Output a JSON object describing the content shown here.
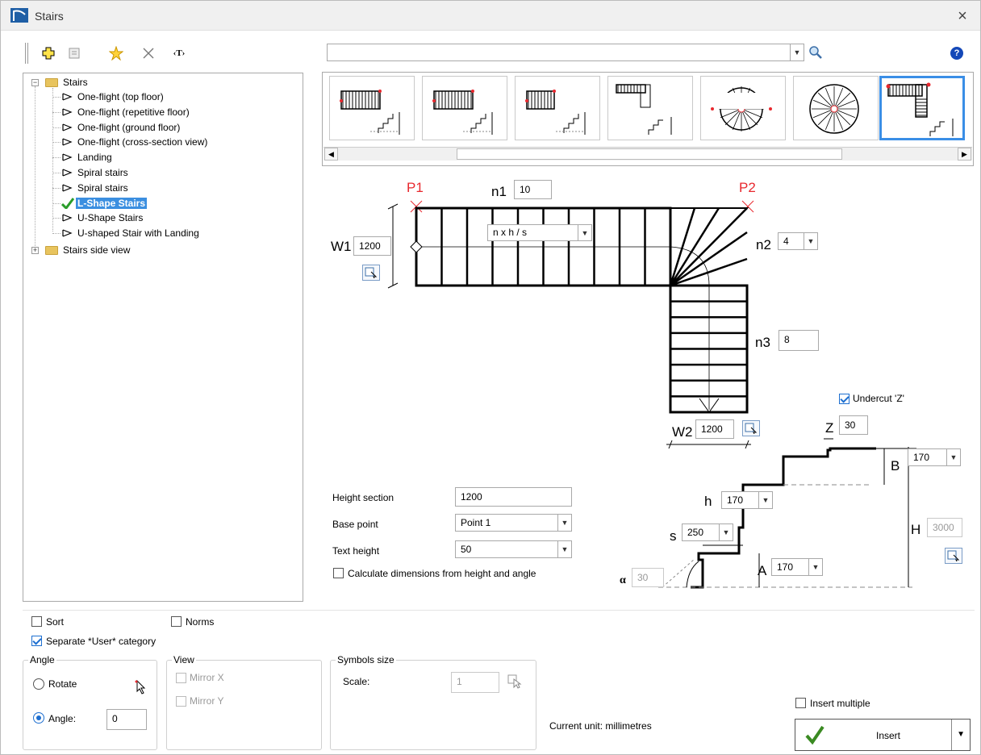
{
  "window": {
    "title": "Stairs",
    "close": "×"
  },
  "toolbar": {
    "add_icon": "plus-icon",
    "properties_icon": "properties-icon",
    "favorite_icon": "star-icon",
    "delete_icon": "delete-icon",
    "text_label": "‹T›",
    "search_value": "",
    "help": "?"
  },
  "tree": {
    "root": "Stairs",
    "items": [
      "One-flight (top floor)",
      "One-flight (repetitive floor)",
      "One-flight (ground floor)",
      "One-flight (cross-section view)",
      "Landing",
      "Spiral stairs",
      "Spiral stairs",
      "L-Shape Stairs",
      "U-Shape Stairs",
      "U-shaped Stair with Landing"
    ],
    "selected_index": 7,
    "second_root": "Stairs side view"
  },
  "diagram": {
    "p1": "P1",
    "p2": "P2",
    "n1_label": "n1",
    "n1_value": "10",
    "n2_label": "n2",
    "n2_value": "4",
    "n3_label": "n3",
    "n3_value": "8",
    "w1_label": "W1",
    "w1_value": "1200",
    "w2_label": "W2",
    "w2_value": "1200",
    "formula": "n x h / s",
    "undercut_label": "Undercut 'Z'",
    "z_label": "Z",
    "z_value": "30",
    "b_label": "B",
    "b_value": "170",
    "h_label": "h",
    "h_value": "170",
    "s_label": "s",
    "s_value": "250",
    "a_label": "A",
    "a_value": "170",
    "H_label": "H",
    "H_value": "3000",
    "alpha_label": "α",
    "alpha_value": "30"
  },
  "settings": {
    "height_section_label": "Height section",
    "height_section_value": "1200",
    "base_point_label": "Base point",
    "base_point_value": "Point 1",
    "text_height_label": "Text height",
    "text_height_value": "50",
    "calc_label": "Calculate dimensions from height and angle"
  },
  "bottom": {
    "sort_label": "Sort",
    "norms_label": "Norms",
    "separate_label": "Separate *User* category",
    "angle_title": "Angle",
    "rotate_label": "Rotate",
    "angle_label": "Angle:",
    "angle_value": "0",
    "view_title": "View",
    "mirror_x": "Mirror X",
    "mirror_y": "Mirror Y",
    "symbols_title": "Symbols size",
    "scale_label": "Scale:",
    "scale_value": "1",
    "unit_text": "Current unit: millimetres",
    "insert_multiple": "Insert multiple",
    "insert_label": "Insert"
  }
}
